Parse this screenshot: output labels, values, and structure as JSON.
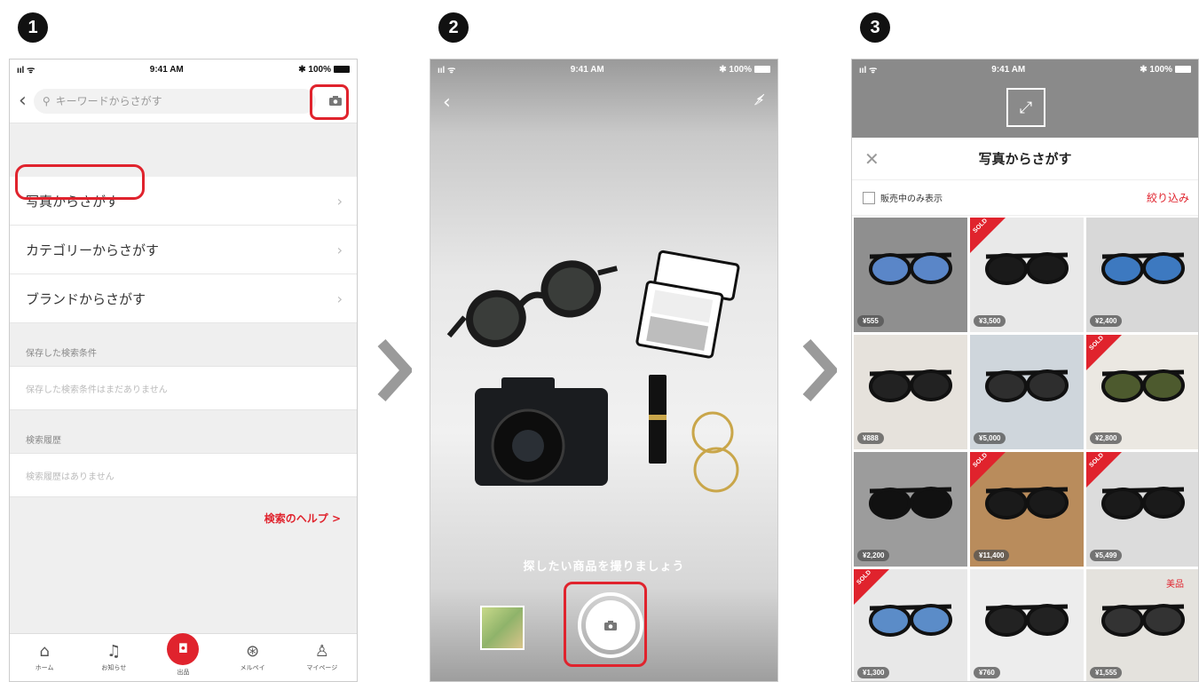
{
  "steps": [
    "1",
    "2",
    "3"
  ],
  "phone1": {
    "status": {
      "signal": "ııl ᯤ",
      "time": "9:41 AM",
      "battery": "✱ 100%"
    },
    "search": {
      "placeholder": "キーワードからさがす"
    },
    "menu": [
      {
        "label": "写真からさがす"
      },
      {
        "label": "カテゴリーからさがす"
      },
      {
        "label": "ブランドからさがす"
      }
    ],
    "saved": {
      "heading": "保存した検索条件",
      "empty": "保存した検索条件はまだありません"
    },
    "history": {
      "heading": "検索履歴",
      "empty": "検索履歴はありません"
    },
    "help_link": "検索のヘルプ >",
    "tabs": [
      {
        "icon": "home-icon",
        "glyph": "⌂",
        "label": "ホーム"
      },
      {
        "icon": "bell-icon",
        "glyph": "♫",
        "label": "お知らせ"
      },
      {
        "icon": "camera-icon",
        "glyph": "◘",
        "label": "出品"
      },
      {
        "icon": "merpay-icon",
        "glyph": "⊛",
        "label": "メルペイ"
      },
      {
        "icon": "user-icon",
        "glyph": "♙",
        "label": "マイページ"
      }
    ]
  },
  "phone2": {
    "status": {
      "signal": "ııl ᯤ",
      "time": "9:41 AM",
      "battery": "✱ 100%"
    },
    "prompt": "探したい商品を撮りましょう"
  },
  "phone3": {
    "status": {
      "signal": "ııl ᯤ",
      "time": "9:41 AM",
      "battery": "✱ 100%"
    },
    "title": "写真からさがす",
    "filter_label": "販売中のみ表示",
    "filter_link": "絞り込み",
    "sold_label": "SOLD",
    "items": [
      {
        "price": "¥555",
        "sold": false,
        "bg": "#8f8f8f",
        "lens": "#5a86c8"
      },
      {
        "price": "¥3,500",
        "sold": true,
        "bg": "#e9e9e9",
        "lens": "#1a1a1a"
      },
      {
        "price": "¥2,400",
        "sold": false,
        "bg": "#d8d8d8",
        "lens": "#3d79c0"
      },
      {
        "price": "¥888",
        "sold": false,
        "bg": "#e6e2dc",
        "lens": "#222222"
      },
      {
        "price": "¥5,000",
        "sold": false,
        "bg": "#cfd6dc",
        "lens": "#2e2e2e"
      },
      {
        "price": "¥2,800",
        "sold": true,
        "bg": "#ebe8e2",
        "lens": "#4d5a2e"
      },
      {
        "price": "¥2,200",
        "sold": false,
        "bg": "#9c9c9c",
        "lens": "#111111"
      },
      {
        "price": "¥11,400",
        "sold": true,
        "bg": "#b98c5c",
        "lens": "#1a1a1a"
      },
      {
        "price": "¥5,499",
        "sold": true,
        "bg": "#dcdcdc",
        "lens": "#1a1a1a"
      },
      {
        "price": "¥1,300",
        "sold": true,
        "bg": "#e8e8e8",
        "lens": "#5b8cc8"
      },
      {
        "price": "¥760",
        "sold": false,
        "bg": "#ededed",
        "lens": "#222222"
      },
      {
        "price": "¥1,555",
        "sold": false,
        "bg": "#e4e2dd",
        "lens": "#333333",
        "badge": "美品"
      }
    ]
  }
}
